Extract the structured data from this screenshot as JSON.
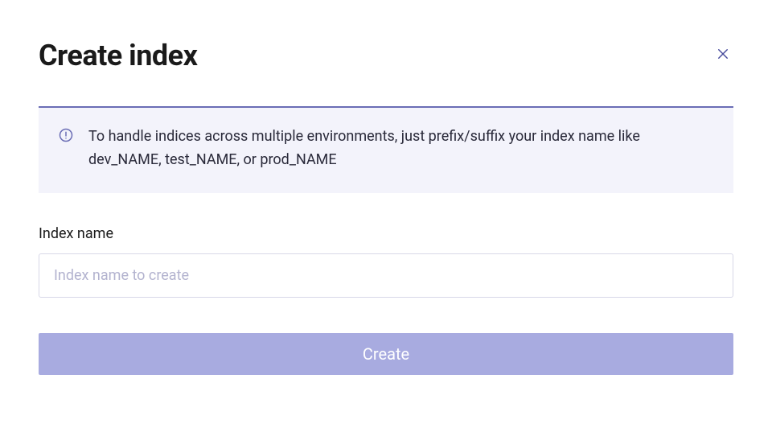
{
  "header": {
    "title": "Create index"
  },
  "info": {
    "text": "To handle indices across multiple environments, just prefix/suffix your index name like dev_NAME, test_NAME, or prod_NAME"
  },
  "form": {
    "index_name_label": "Index name",
    "index_name_placeholder": "Index name to create",
    "index_name_value": ""
  },
  "actions": {
    "create_label": "Create"
  }
}
